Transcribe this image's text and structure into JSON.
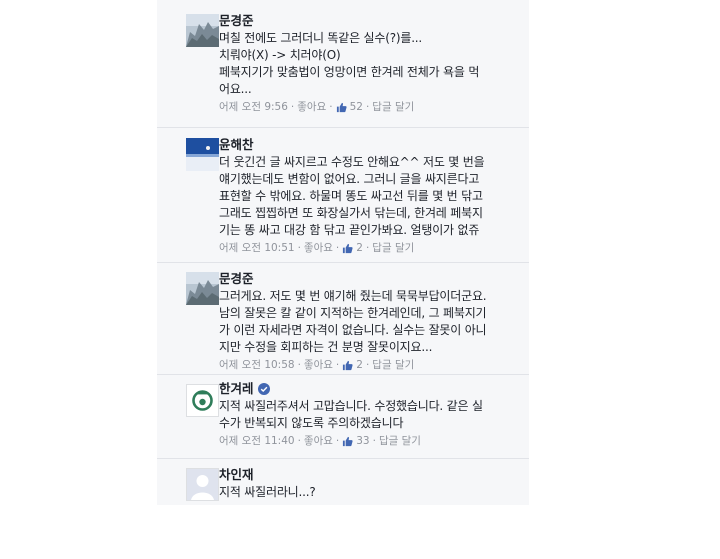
{
  "comments": [
    {
      "author": "문경준",
      "lines": [
        "며칠 전에도 그러더니 똑같은 실수(?)를...",
        "치뤄야(X) -> 치러야(O)",
        "페북지기가 맞춤법이 엉망이면 한겨레 전체가 욕을 먹",
        "어요..."
      ],
      "time": "어제 오전 9:56",
      "like": "좋아요",
      "likes": "52",
      "reply": "답글 달기"
    },
    {
      "author": "윤해찬",
      "lines": [
        "더 웃긴건 글 싸지르고 수정도 안해요^^ 저도 몇 번을",
        "얘기했는데도 변함이 없어요. 그러니 글을 싸지른다고",
        "표현할 수 밖에요. 하물며 똥도 싸고선 뒤를 몇 번 닦고",
        "그래도 찝찝하면 또 화장실가서 닦는데, 한겨레 페북지",
        "기는 똥 싸고 대강 함 닦고 끝인가봐요. 얼탱이가 없쥬"
      ],
      "time": "어제 오전 10:51",
      "like": "좋아요",
      "likes": "2",
      "reply": "답글 달기"
    },
    {
      "author": "문경준",
      "lines": [
        "그러게요. 저도 몇 번 얘기해 줬는데 묵묵부답이더군요.",
        "남의 잘못은 칼 같이 지적하는 한겨레인데, 그 페북지기",
        "가 이런 자세라면 자격이 없습니다. 실수는 잘못이 아니",
        "지만 수정을 회피하는 건 분명 잘못이지요..."
      ],
      "time": "어제 오전 10:58",
      "like": "좋아요",
      "likes": "2",
      "reply": "답글 달기"
    },
    {
      "author": "한겨레",
      "verified": true,
      "lines": [
        "지적 싸질러주셔서 고맙습니다. 수정했습니다. 같은 실",
        "수가 반복되지 않도록 주의하겠습니다"
      ],
      "time": "어제 오전 11:40",
      "like": "좋아요",
      "likes": "33",
      "reply": "답글 달기"
    },
    {
      "author": "차인재",
      "lines": [
        "지적 싸질러라니...?"
      ]
    }
  ],
  "colors": {
    "name": "#1d2129",
    "meta": "#90949c",
    "like_blue": "#4267b2",
    "verified": "#4267b2",
    "hani_green": "#2f7d5a"
  },
  "icons": {
    "like": "thumbs-up-icon",
    "verified": "verified-badge-icon"
  }
}
